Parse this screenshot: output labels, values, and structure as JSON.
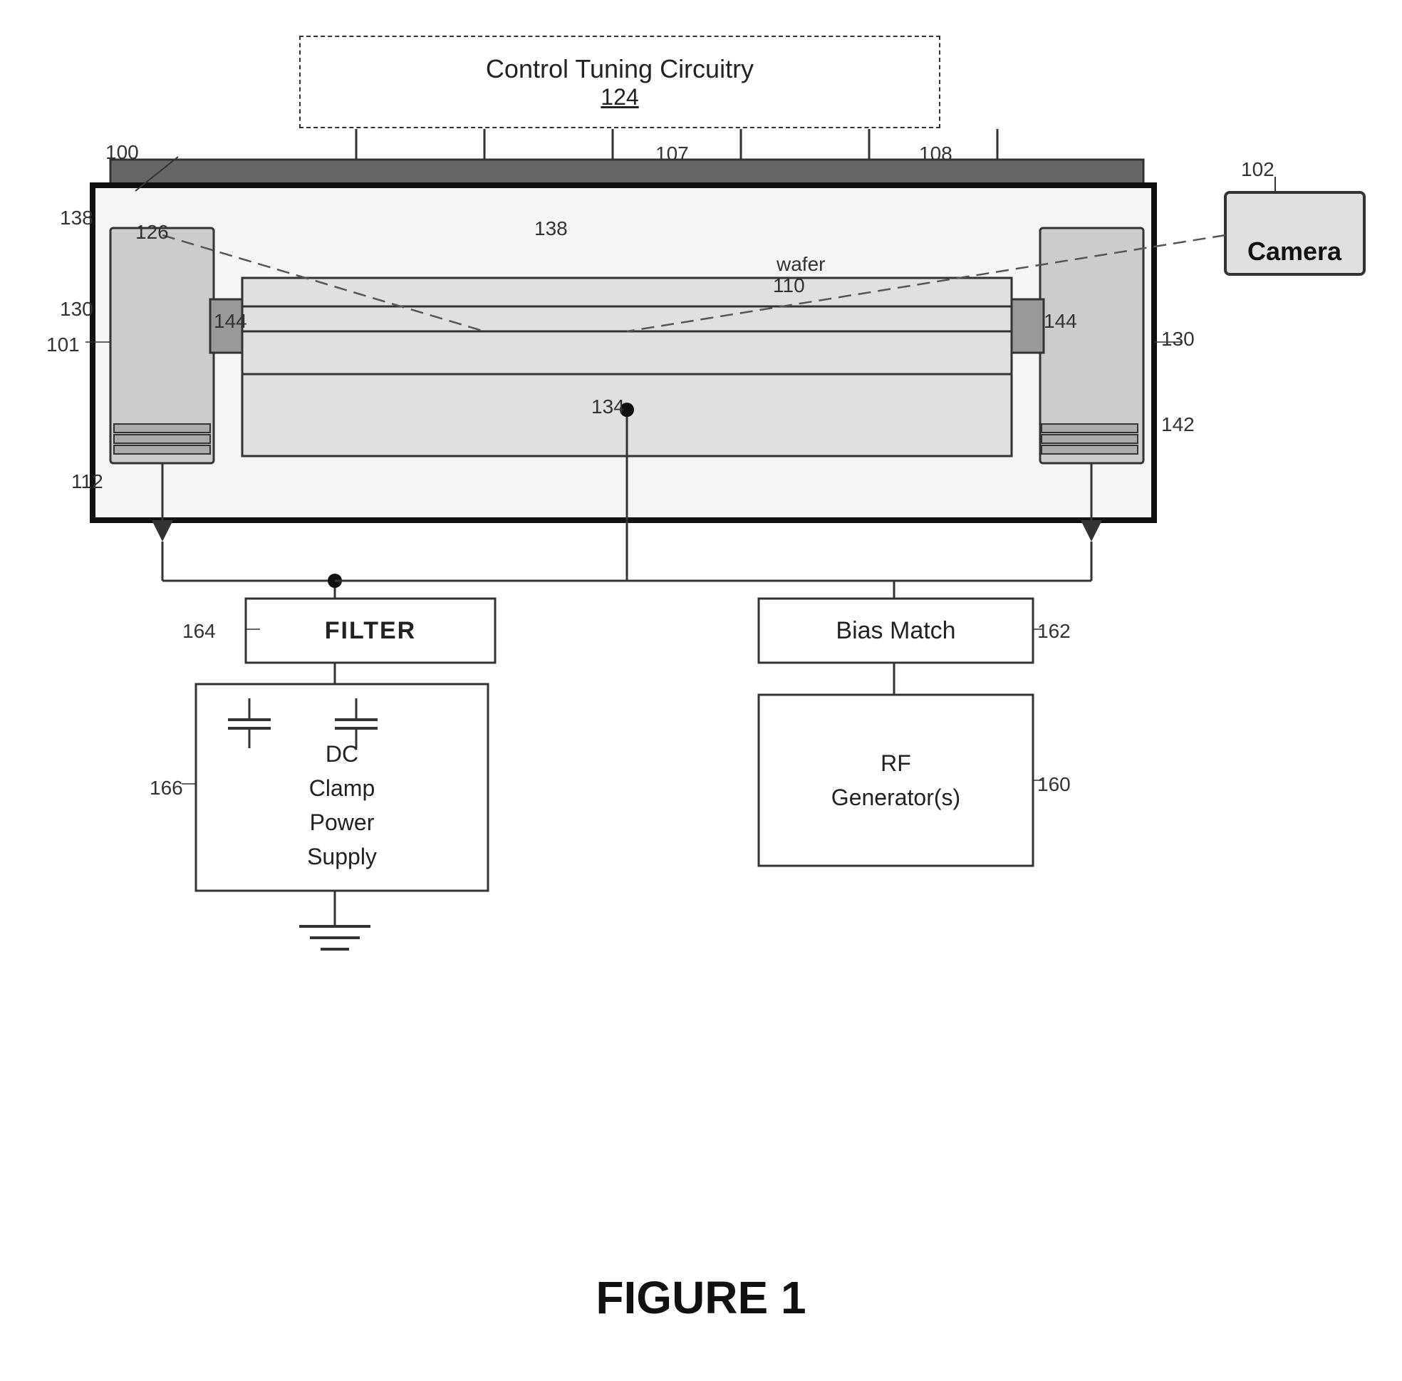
{
  "title": "FIGURE 1",
  "diagram": {
    "control_box": {
      "title": "Control Tuning Circuitry",
      "number": "124"
    },
    "labels": {
      "camera": "Camera",
      "filter": "FILTER",
      "dc_clamp": "DC\nClamp\nPower\nSupply",
      "bias_match": "Bias Match",
      "rf_generator": "RF\nGenerator(s)"
    },
    "ref_numbers": {
      "r100": "100",
      "r101": "101",
      "r102": "102",
      "r107": "107",
      "r108": "108",
      "r110": "110",
      "r112": "112",
      "r126": "126",
      "r130": "130",
      "r134": "134",
      "r138_left": "138",
      "r138_right": "138",
      "r142": "142",
      "r144_left": "144",
      "r144_right": "144",
      "r160": "160",
      "r162": "162",
      "r164": "164",
      "r166": "166",
      "wafer": "wafer"
    },
    "figure_label": "FIGURE 1"
  }
}
